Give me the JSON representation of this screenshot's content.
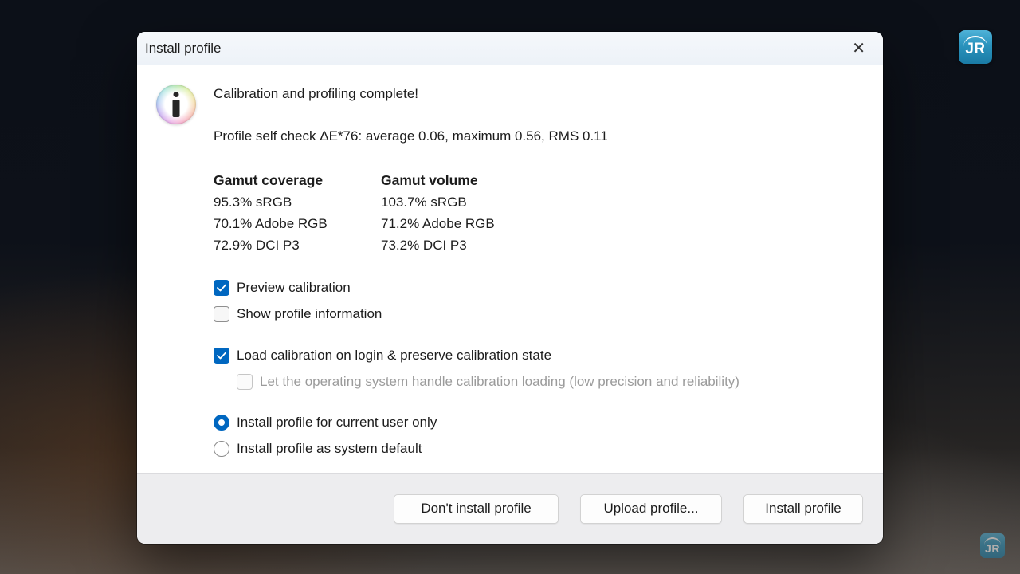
{
  "window": {
    "title": "Install profile",
    "close_icon": "✕"
  },
  "message": {
    "headline": "Calibration and profiling complete!",
    "self_check": "Profile self check ΔE*76: average 0.06, maximum 0.56, RMS 0.11"
  },
  "gamut": {
    "coverage": {
      "header": "Gamut coverage",
      "rows": [
        "95.3% sRGB",
        "70.1% Adobe RGB",
        "72.9% DCI P3"
      ]
    },
    "volume": {
      "header": "Gamut volume",
      "rows": [
        "103.7% sRGB",
        "71.2% Adobe RGB",
        "73.2% DCI P3"
      ]
    }
  },
  "options": {
    "preview_calibration": {
      "label": "Preview calibration",
      "checked": true
    },
    "show_profile_information": {
      "label": "Show profile information",
      "checked": false
    },
    "load_calibration": {
      "label": "Load calibration on login & preserve calibration state",
      "checked": true
    },
    "os_handles_calibration": {
      "label": "Let the operating system handle calibration loading (low precision and reliability)",
      "checked": false,
      "disabled": true
    },
    "install_current_user": {
      "label": "Install profile for current user only",
      "selected": true
    },
    "install_system_default": {
      "label": "Install profile as system default",
      "selected": false
    }
  },
  "buttons": {
    "dont_install": "Don't install profile",
    "upload": "Upload profile...",
    "install": "Install profile"
  },
  "watermark": {
    "text": "JR"
  },
  "colors": {
    "accent": "#0067c0",
    "dialog_bg": "#ffffff",
    "footer_bg": "#ededef",
    "titlebar_bg": "#f0f4f9",
    "disabled_text": "#9b9b9b",
    "watermark_blue": "#2a93bd"
  }
}
